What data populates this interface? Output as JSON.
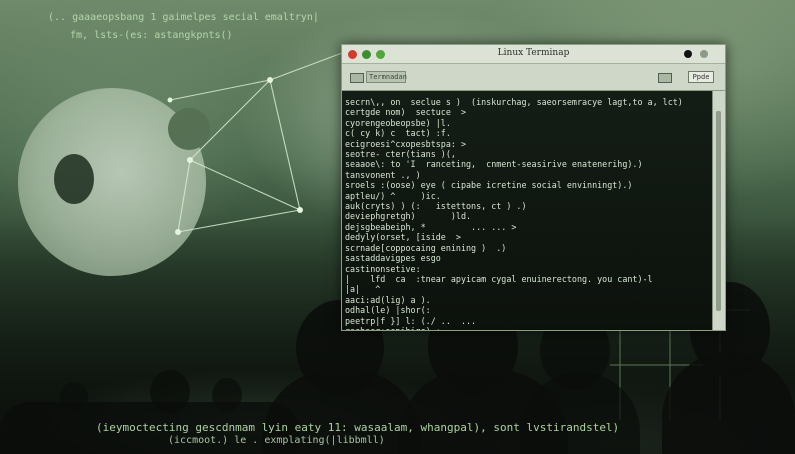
{
  "background_code": {
    "top_line_1": "(.. gaaaeopsbang 1  gaimelpes secial emaltryn|",
    "top_line_2": "fm, lsts-(es:  astangkpnts()",
    "bottom_line_1": "(ieymoctecting gescdnmam lyin eaty 11: wasaalam, whangpal), sont lvstirandstel)",
    "bottom_line_2": "(iccmoot.) le . exmplating(|libbmll)"
  },
  "terminal": {
    "title": "Linux Terminap",
    "toolbar_field": "Termnadan",
    "toolbar_button": "Ppde",
    "lines": [
      "secrn\\,, on  seclue s )  (inskurchag, saeorsemracye lagt,to a, lct)",
      "certgde nom)  sectuce  >",
      "cyorengeobeopsbe) |l.",
      "c( cy k) c  tact) :f.",
      "ecigroesi^cxopesbtspa: >",
      "seotre- cter(tians )(,",
      "seaaoe\\: to 'I  ranceting,  cnment-seasirive enatenerihg).)",
      "tansvonent ., )",
      "sroels :(oose) eye ( cipabe icretine social envinningt).)",
      "aptleu/) ^     )ic.",
      "auk(cryts) ) (:   istettons, ct ) .)",
      "deviephgretgh)       )ld.",
      "dejsgbeabeiph, *         ... ... >",
      "dedyly(orset, [iside  >",
      "scrnade[coppocaing enining )  .)",
      "sastaddavigpes esgo",
      "castinonsetive:",
      "|    lfd  ca  :tnear apyicam cygal enuinerectong. you cant)-l",
      "|a|   ^",
      "aaci:ad(lig) a ).",
      "odhal(le) |shor(:",
      "peetrp|f }] l: (./ ..  ...",
      "reeheer:sepihige) :",
      "rectseseiyse  t)  )",
      "s  asteeniwriepoor  >"
    ]
  },
  "colors": {
    "terminal_text": "#d7e6d2",
    "titlebar": "#dce3d6",
    "close": "#d43a2f",
    "minimize": "#3d8f2e",
    "maximize": "#4ea839"
  },
  "icons": {
    "emblem": "social-engineering-emblem",
    "network": "network-graph",
    "toolbar_left": "folder-icon",
    "toolbar_right": "tab-icon"
  }
}
